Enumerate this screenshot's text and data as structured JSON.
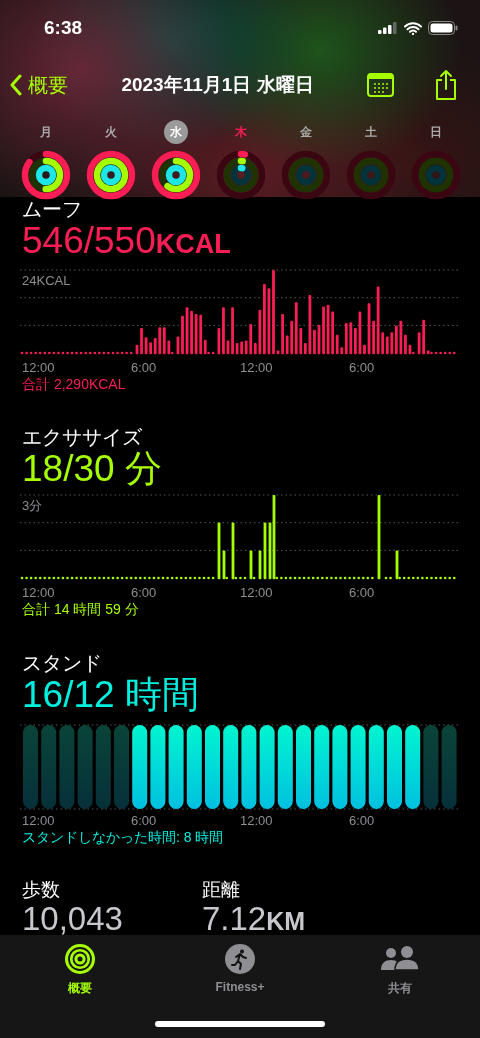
{
  "status_bar": {
    "time": "6:38"
  },
  "nav": {
    "back_label": "概要",
    "title": "2023年11月1日 水曜日"
  },
  "days": [
    {
      "label": "月",
      "selected": false,
      "today": false
    },
    {
      "label": "火",
      "selected": false,
      "today": false
    },
    {
      "label": "水",
      "selected": true,
      "today": false
    },
    {
      "label": "木",
      "selected": false,
      "today": true
    },
    {
      "label": "金",
      "selected": false,
      "today": false
    },
    {
      "label": "土",
      "selected": false,
      "today": false
    },
    {
      "label": "日",
      "selected": false,
      "today": false
    }
  ],
  "sections": [
    {
      "kind": "move",
      "title": "ムーフ",
      "value": "546/550",
      "unit": "KCAL",
      "grid_label": "24KCAL",
      "x_labels": [
        "12:00",
        "6:00",
        "12:00",
        "6:00"
      ],
      "total": "合計 2,290KCAL"
    },
    {
      "kind": "exercise",
      "title": "エクササイズ",
      "value": "18/30",
      "unit": "分",
      "grid_label": "3分",
      "x_labels": [
        "12:00",
        "6:00",
        "12:00",
        "6:00"
      ],
      "total": "合計 14 時間 59 分"
    },
    {
      "kind": "stand",
      "title": "スタンド",
      "value": "16/12",
      "unit": "時間",
      "x_labels": [
        "12:00",
        "6:00",
        "12:00",
        "6:00"
      ],
      "total": "スタンドしなかった時間: 8 時間"
    }
  ],
  "stats": [
    {
      "label": "歩数",
      "value": "10,043"
    },
    {
      "label": "距離",
      "value": "7.12",
      "unit": "KM"
    }
  ],
  "tab_bar": [
    {
      "kind": "rings",
      "label": "概要",
      "selected": true
    },
    {
      "kind": "runner",
      "label": "Fitness+",
      "selected": false
    },
    {
      "kind": "people",
      "label": "共有",
      "selected": false
    }
  ]
}
